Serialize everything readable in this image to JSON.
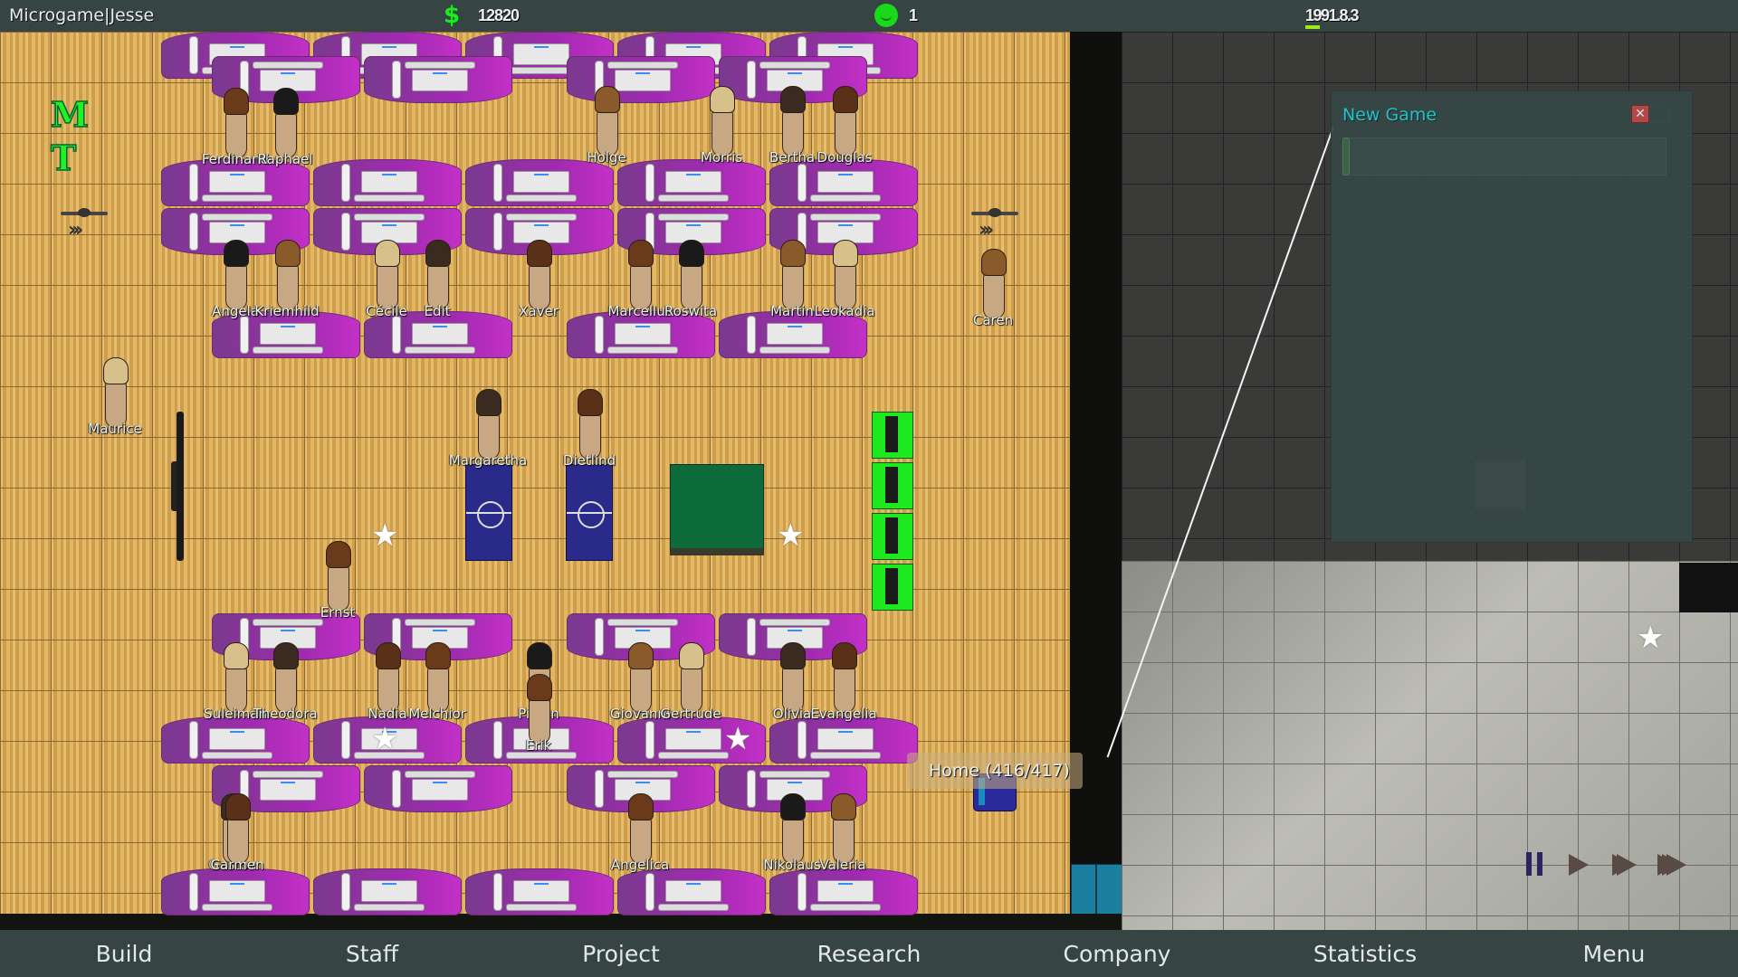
{
  "topbar": {
    "title": "Microgame|Jesse",
    "money": "12820",
    "reputation": "1",
    "date": "1991.8.3",
    "money_icon": "dollar-icon",
    "reputation_icon": "smiley-icon"
  },
  "hud": {
    "letters": [
      "M",
      "T"
    ]
  },
  "employees": {
    "row1": [
      "Ferdinand",
      "Raphael",
      "Holge",
      "Morris",
      "Bertha",
      "Douglas"
    ],
    "row2": [
      "Angela",
      "Kriemhild",
      "Cécile",
      "Edit",
      "Xaver",
      "Marcellus",
      "Roswita",
      "Martin",
      "Leokadia"
    ],
    "standing": [
      "Caren",
      "Maurice",
      "Margaretha",
      "Dietlind",
      "Ernst"
    ],
    "row3": [
      "Suleiman",
      "Theodora",
      "Nadia",
      "Melchior",
      "Pippin",
      "Giovanni",
      "Gertrude",
      "Olivia",
      "Evangelia",
      "Erik"
    ],
    "row4": [
      "Gaston",
      "Carmen",
      "Angelica",
      "Nikolaus",
      "Valeria"
    ]
  },
  "tooltip": {
    "text": "Home (416/417)"
  },
  "dialog": {
    "title": "New Game",
    "input_value": "",
    "close_label": "✕"
  },
  "speed_controls": [
    "pause",
    "play",
    "fast",
    "fastest"
  ],
  "nav": {
    "items": [
      "Build",
      "Staff",
      "Project",
      "Research",
      "Company",
      "Statistics",
      "Menu"
    ]
  },
  "colors": {
    "bar_bg": "#364444",
    "accent_green": "#1ee81e",
    "dialog_title": "#20c4c8",
    "desk_purple": "#a02ab0"
  }
}
